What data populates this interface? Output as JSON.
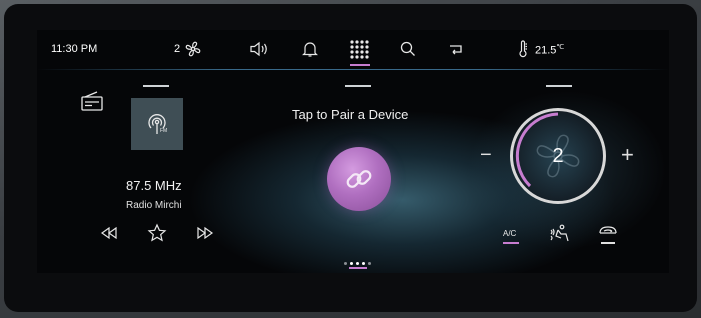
{
  "status_bar": {
    "time": "11:30 PM",
    "fan_speed": "2",
    "temperature": "21.5",
    "temperature_unit": "℃",
    "icons": [
      "fan-icon",
      "volume-icon",
      "bell-icon",
      "apps-grid-icon",
      "search-icon",
      "return-icon",
      "thermometer-icon"
    ],
    "active_icon": "apps-grid-icon"
  },
  "radio": {
    "source_icon": "radio-icon",
    "station_logo": "fm-broadcast-icon",
    "frequency": "87.5 MHz",
    "station_name": "Radio Mirchi",
    "controls": [
      "rewind-icon",
      "favorite-star-icon",
      "fast-forward-icon"
    ]
  },
  "pairing": {
    "title": "Tap to Pair a Device",
    "button_icon": "link-icon"
  },
  "climate": {
    "fan_level": "2",
    "decrease_label": "−",
    "increase_label": "+",
    "ac_label": "A/C",
    "seat_icon": "seat-airflow-icon",
    "recirculation_icon": "recirculation-icon"
  },
  "pager": {
    "pages": 5,
    "active_page": 3
  },
  "colors": {
    "accent": "#c77dd0",
    "background": "#050608",
    "tile": "#3f4e55"
  }
}
